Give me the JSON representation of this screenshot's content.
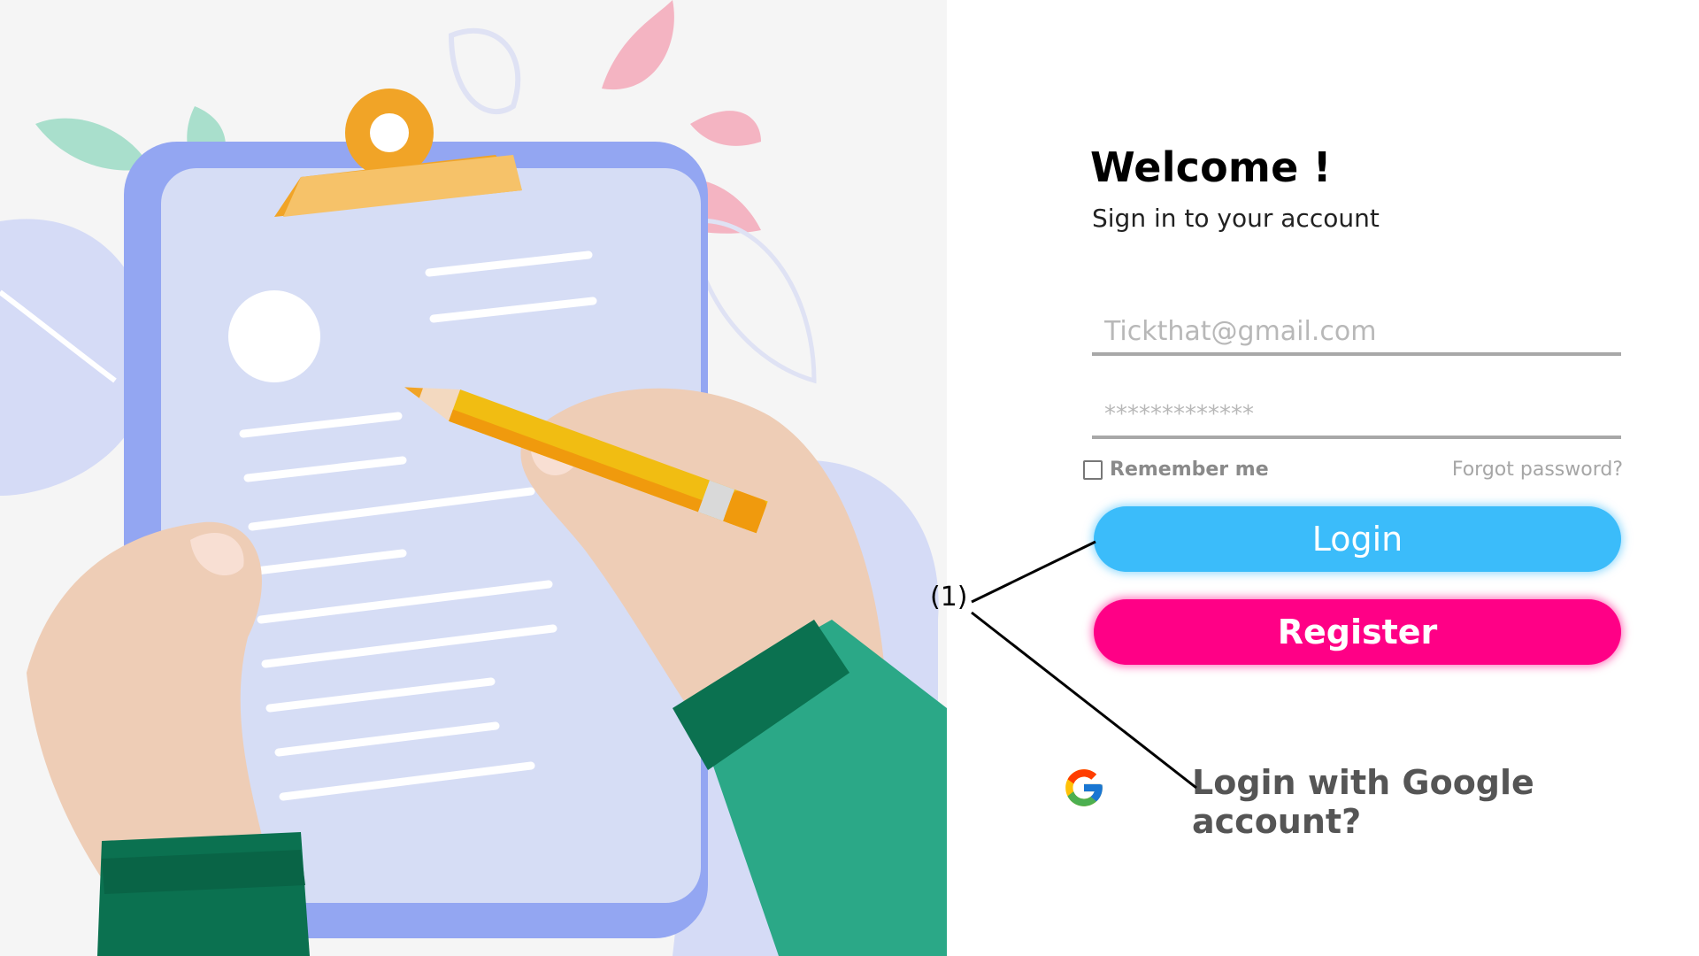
{
  "login_form": {
    "title": "Welcome !",
    "subtitle": "Sign in to your account",
    "email_placeholder": "Tickthat@gmail.com",
    "password_placeholder": "*************",
    "remember_label": "Remember me",
    "forgot_label": "Forgot password?",
    "login_label": "Login",
    "register_label": "Register",
    "google_label": "Login with Google account?"
  },
  "annotation": {
    "callout_label": "(1)"
  },
  "icons": {
    "illustration": "clipboard-writing-illustration",
    "google": "google-icon"
  },
  "colors": {
    "login_button": "#3bbcfa",
    "register_button": "#ff0086",
    "input_underline": "#a8a8a8",
    "title_text": "#000000"
  }
}
